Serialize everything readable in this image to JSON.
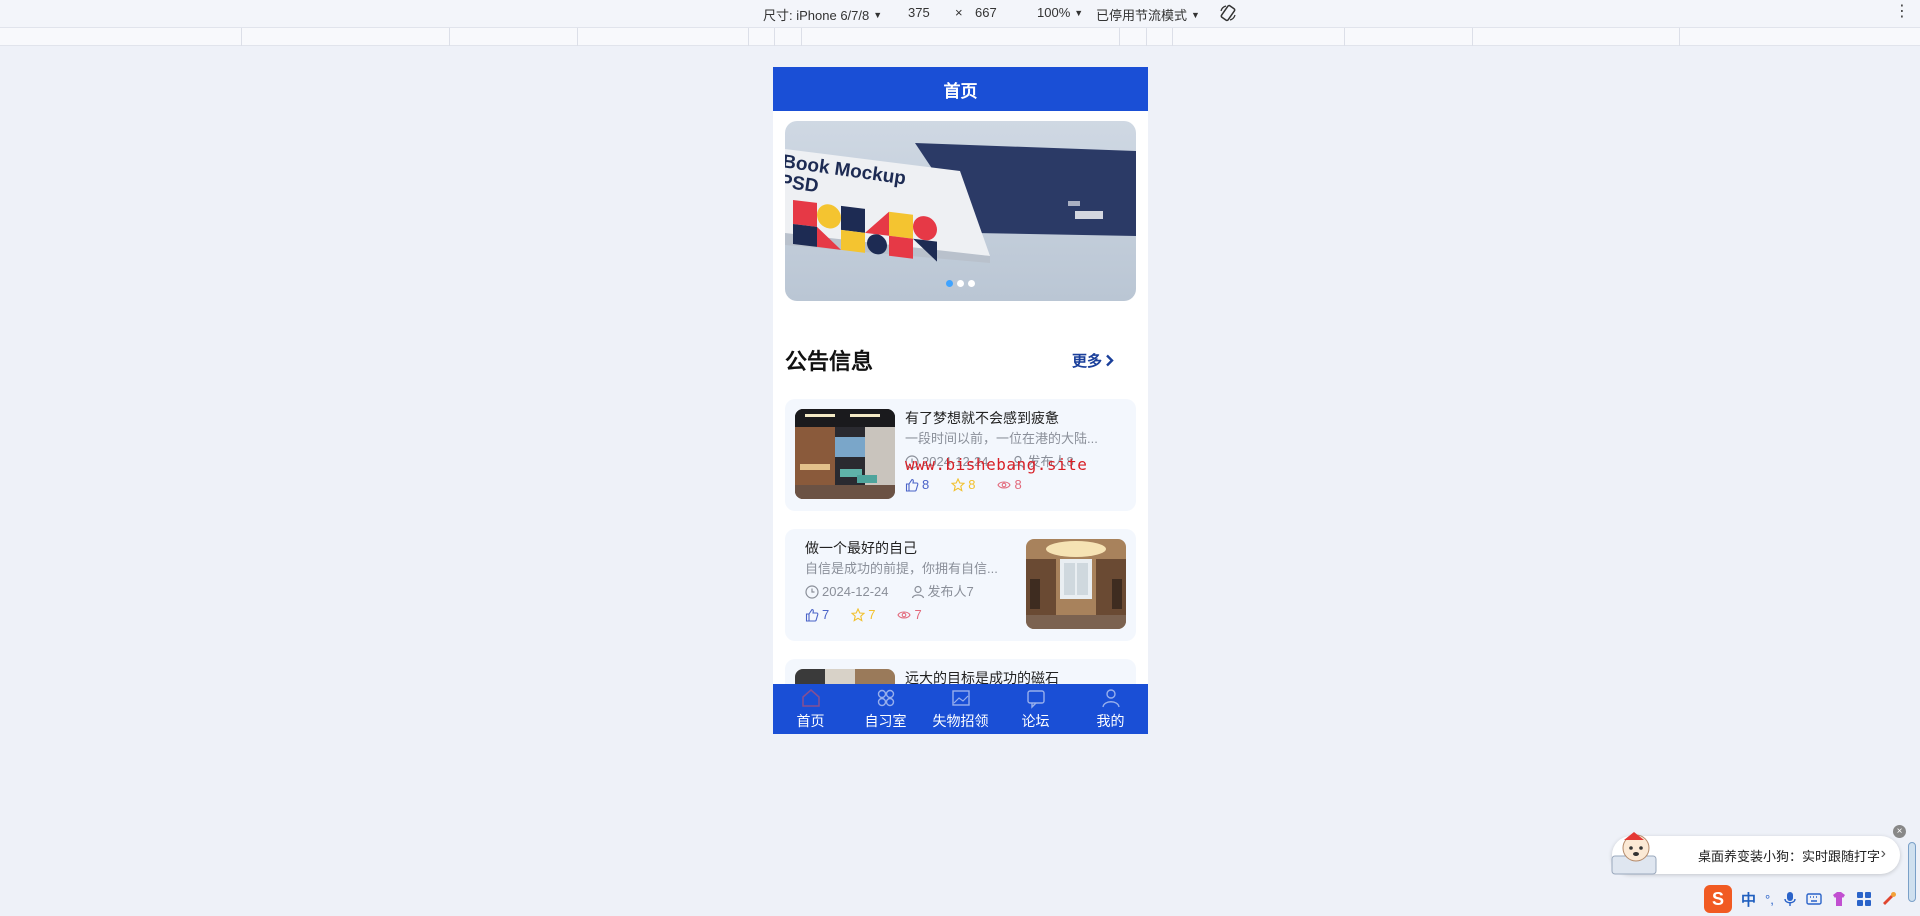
{
  "devtools": {
    "device_label": "尺寸: iPhone 6/7/8",
    "width": "375",
    "times": "×",
    "height": "667",
    "zoom": "100%",
    "throttle": "已停用节流模式",
    "kebab": "⋮"
  },
  "app": {
    "header_title": "首页",
    "banner": {
      "mockup_line1": "Book Mockup",
      "mockup_line2": "PSD",
      "active_slide": 1,
      "slide_count": 3
    },
    "notice_section": {
      "title": "公告信息",
      "more_label": "更多"
    },
    "notices": [
      {
        "title": "有了梦想就不会感到疲惫",
        "desc": "一段时间以前，一位在港的大陆...",
        "date": "2024-12-24",
        "author": "发布人8",
        "likes": "8",
        "favs": "8",
        "views": "8",
        "image_side": "left"
      },
      {
        "title": "做一个最好的自己",
        "desc": "自信是成功的前提，你拥有自信...",
        "date": "2024-12-24",
        "author": "发布人7",
        "likes": "7",
        "favs": "7",
        "views": "7",
        "image_side": "right"
      },
      {
        "title": "远大的目标是成功的磁石",
        "image_side": "left"
      }
    ],
    "watermark": "www.bishebang.site",
    "tabs": [
      {
        "label": "首页",
        "icon": "home-icon"
      },
      {
        "label": "自习室",
        "icon": "grid-icon"
      },
      {
        "label": "失物招领",
        "icon": "image-icon"
      },
      {
        "label": "论坛",
        "icon": "chat-icon"
      },
      {
        "label": "我的",
        "icon": "user-icon"
      }
    ]
  },
  "desktop_pet": {
    "message": "桌面养变装小狗：实时跟随打字",
    "arrow": "›",
    "close": "×"
  },
  "ime": {
    "logo": "S",
    "mode": "中",
    "punct": "°,",
    "icons": [
      "mic-icon",
      "keyboard-icon",
      "skin-icon",
      "apps-icon",
      "tools-icon"
    ]
  },
  "colors": {
    "primary": "#1a4fd6",
    "like": "#4a63c8",
    "fav": "#f2c12e",
    "view": "#e26a7c",
    "watermark": "#d81f26"
  }
}
